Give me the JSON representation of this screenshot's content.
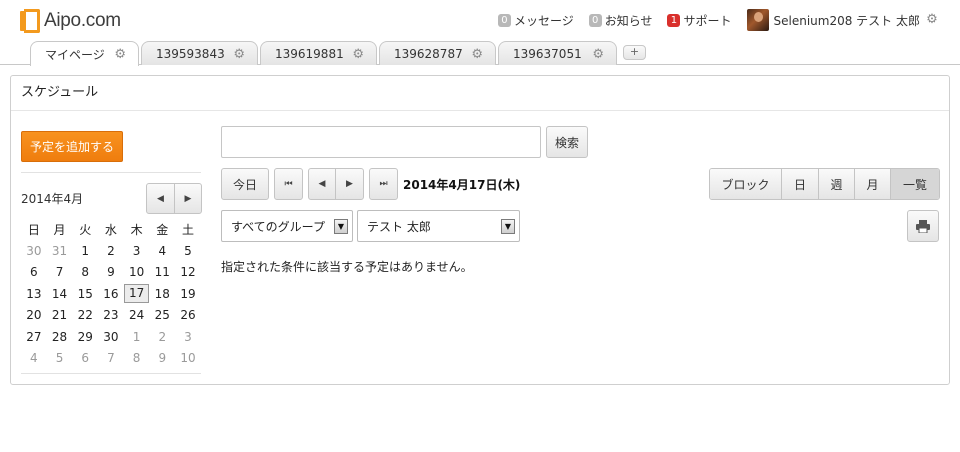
{
  "header": {
    "logo_text": "Aipo.com",
    "nav": [
      {
        "badge": "0",
        "label": "メッセージ",
        "badge_color": "#b8b8b8"
      },
      {
        "badge": "0",
        "label": "お知らせ",
        "badge_color": "#b8b8b8"
      },
      {
        "badge": "1",
        "label": "サポート",
        "badge_color": "#d9302c"
      }
    ],
    "user_name": "Selenium208 テスト 太郎"
  },
  "tabs": [
    {
      "label": "マイページ",
      "active": true
    },
    {
      "label": "139593843",
      "active": false
    },
    {
      "label": "139619881",
      "active": false
    },
    {
      "label": "139628787",
      "active": false
    },
    {
      "label": "139637051",
      "active": false
    }
  ],
  "tab_add_label": "+",
  "portlet": {
    "title": "スケジュール",
    "add_button": "予定を追加する",
    "search": {
      "value": "",
      "placeholder": "",
      "button": "検索"
    },
    "today_button": "今日",
    "current_date": "2014年4月17日(木)",
    "views": [
      "ブロック",
      "日",
      "週",
      "月",
      "一覧"
    ],
    "selected_view": "一覧",
    "group_select": "すべてのグループ",
    "member_select": "テスト 太郎",
    "no_schedule_message": "指定された条件に該当する予定はありません。"
  },
  "mini_calendar": {
    "month_label": "2014年4月",
    "weekdays": [
      "日",
      "月",
      "火",
      "水",
      "木",
      "金",
      "土"
    ],
    "weeks": [
      [
        "30",
        "31",
        "1",
        "2",
        "3",
        "4",
        "5"
      ],
      [
        "6",
        "7",
        "8",
        "9",
        "10",
        "11",
        "12"
      ],
      [
        "13",
        "14",
        "15",
        "16",
        "17",
        "18",
        "19"
      ],
      [
        "20",
        "21",
        "22",
        "23",
        "24",
        "25",
        "26"
      ],
      [
        "27",
        "28",
        "29",
        "30",
        "1",
        "2",
        "3"
      ],
      [
        "4",
        "5",
        "6",
        "7",
        "8",
        "9",
        "10"
      ]
    ],
    "today": "17"
  },
  "colors": {
    "accent_orange": "#f08a17",
    "notification_red": "#d9302c"
  }
}
